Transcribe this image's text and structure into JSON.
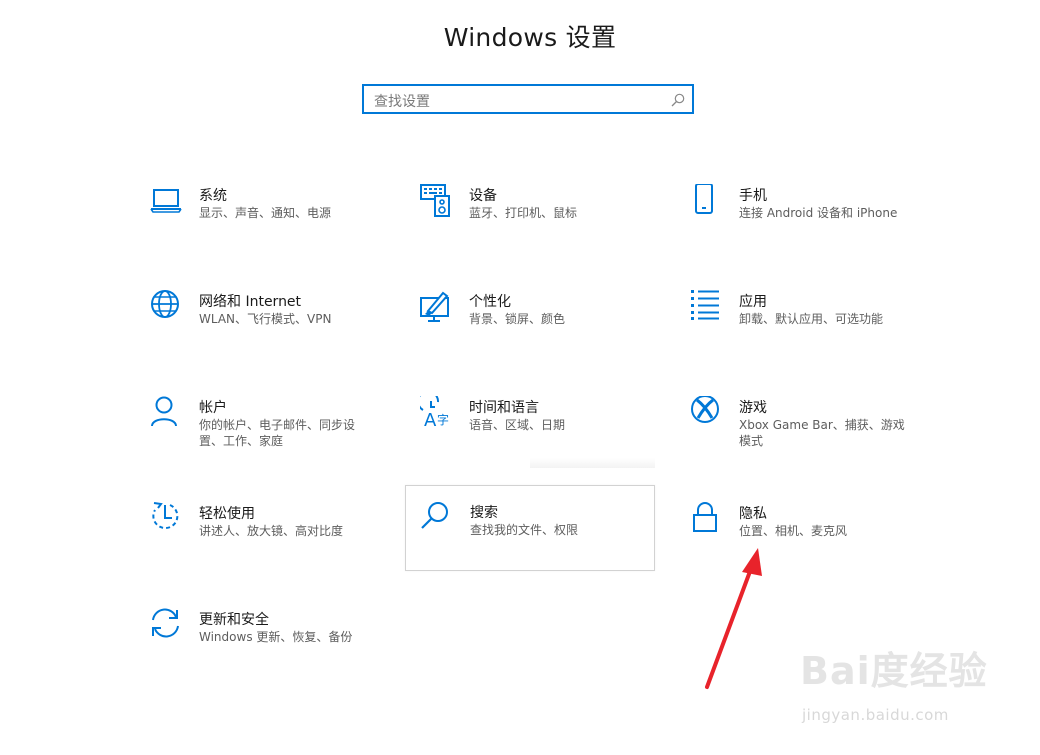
{
  "window": {
    "title": "Windows 设置"
  },
  "search": {
    "placeholder": "查找设置",
    "icon": "search-icon"
  },
  "accent_color": "#0078d7",
  "tiles": [
    {
      "name": "系统",
      "desc": "显示、声音、通知、电源",
      "icon": "laptop-icon"
    },
    {
      "name": "设备",
      "desc": "蓝牙、打印机、鼠标",
      "icon": "devices-icon"
    },
    {
      "name": "手机",
      "desc": "连接 Android 设备和 iPhone",
      "icon": "phone-icon"
    },
    {
      "name": "网络和 Internet",
      "desc": "WLAN、飞行模式、VPN",
      "icon": "globe-icon"
    },
    {
      "name": "个性化",
      "desc": "背景、锁屏、颜色",
      "icon": "personalization-icon"
    },
    {
      "name": "应用",
      "desc": "卸载、默认应用、可选功能",
      "icon": "apps-list-icon"
    },
    {
      "name": "帐户",
      "desc": "你的帐户、电子邮件、同步设置、工作、家庭",
      "icon": "person-icon"
    },
    {
      "name": "时间和语言",
      "desc": "语音、区域、日期",
      "icon": "time-language-icon"
    },
    {
      "name": "游戏",
      "desc": "Xbox Game Bar、捕获、游戏模式",
      "icon": "xbox-icon"
    },
    {
      "name": "轻松使用",
      "desc": "讲述人、放大镜、高对比度",
      "icon": "ease-of-access-icon"
    },
    {
      "name": "搜索",
      "desc": "查找我的文件、权限",
      "icon": "search-icon"
    },
    {
      "name": "隐私",
      "desc": "位置、相机、麦克风",
      "icon": "lock-icon"
    },
    {
      "name": "更新和安全",
      "desc": "Windows 更新、恢复、备份",
      "icon": "update-icon"
    }
  ],
  "watermark": {
    "brand": "Bai度经验",
    "url": "jingyan.baidu.com"
  }
}
